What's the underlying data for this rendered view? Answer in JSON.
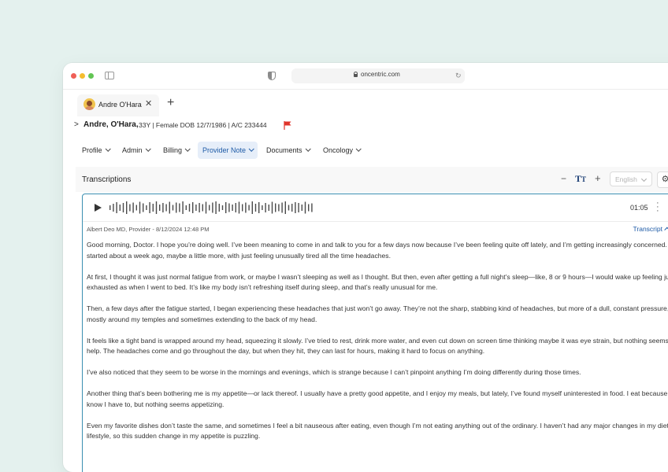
{
  "browser": {
    "url": "oncentric.com",
    "tab_title": "Andre O'Hara"
  },
  "patient": {
    "name": "Andre, O'Hara,",
    "meta": "33Y | Female DOB 12/7/1986 | A/C 233444"
  },
  "nav": {
    "items": [
      {
        "label": "Profile"
      },
      {
        "label": "Admin"
      },
      {
        "label": "Billing"
      },
      {
        "label": "Provider Note",
        "active": true
      },
      {
        "label": "Documents"
      },
      {
        "label": "Oncology"
      }
    ]
  },
  "transcriptions": {
    "title": "Transcriptions",
    "font_icon": "Tт",
    "language_placeholder": "English",
    "audio": {
      "duration": "01:05"
    },
    "author_line": "Albert Deo MD, Provider - 8/12/2024 12:48 PM",
    "toggle_label": "Transcript",
    "paragraphs": [
      "Good morning, Doctor. I hope you’re doing well. I’ve been meaning to come in and talk to you for a few days now because I’ve been feeling quite off lately, and I’m getting increasingly concerned. It all started about a week ago, maybe a little more, with just feeling unusually tired all the time headaches.",
      "At first, I thought it was just normal fatigue from work, or maybe I wasn’t sleeping as well as I thought. But then, even after getting a full night’s sleep—like, 8 or 9 hours—I would wake up feeling just as exhausted as when I went to bed. It’s like my body isn’t refreshing itself during sleep, and that’s really unusual for me.",
      "Then, a few days after the fatigue started, I began experiencing these headaches that just won’t go away. They’re not the sharp, stabbing kind of headaches, but more of a dull, constant pressure, mostly around my temples and sometimes extending to the back of my head.",
      "It feels like a tight band is wrapped around my head, squeezing it slowly. I’ve tried to rest, drink more water, and even cut down on screen time thinking maybe it was eye strain, but nothing seems to help. The headaches come and go throughout the day, but when they hit, they can last for hours, making it hard to focus on anything.",
      "I’ve also noticed that they seem to be worse in the mornings and evenings, which is strange because I can’t pinpoint anything I’m doing differently during those times.",
      "Another thing that’s been bothering me is my appetite—or lack thereof. I usually have a pretty good appetite, and I enjoy my meals, but lately, I’ve found myself uninterested in food. I eat because I know I have to, but nothing seems appetizing.",
      "Even my favorite dishes don’t taste the same, and sometimes I feel a bit nauseous after eating, even though I’m not eating anything out of the ordinary. I haven’t had any major changes in my diet or lifestyle, so this sudden change in my appetite is puzzling."
    ]
  },
  "colors": {
    "background": "#e4f1ee",
    "accent": "#1d5aa6",
    "card_border": "#3b8fb1",
    "flag": "#e0342b"
  }
}
